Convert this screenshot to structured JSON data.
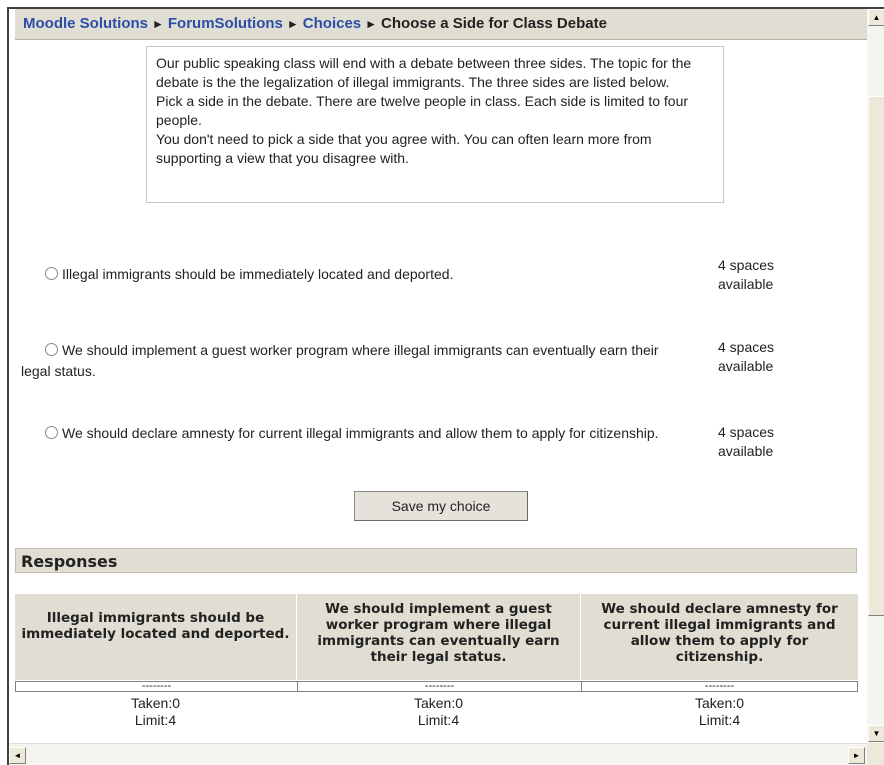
{
  "breadcrumb": {
    "items": [
      "Moodle Solutions",
      "ForumSolutions",
      "Choices"
    ],
    "separator": "►",
    "current": "Choose a Side for Class Debate"
  },
  "intro": {
    "paragraphs": [
      "Our public speaking class will end with a debate between three sides. The topic for the debate is the the legalization of illegal immigrants. The three sides are listed below.",
      "Pick a side in the debate. There are twelve people in class. Each side is limited to four people.",
      "You don't need to pick a side that you agree with. You can often learn more from supporting a view that you disagree with."
    ]
  },
  "options": [
    {
      "label": "Illegal immigrants should be immediately located and deported.",
      "spaces": "4 spaces available"
    },
    {
      "label": "We should implement a guest worker program where illegal immigrants can eventually earn their legal status.",
      "spaces": "4 spaces available"
    },
    {
      "label": "We should declare amnesty for current illegal immigrants and allow them to apply for citizenship.",
      "spaces": "4 spaces available"
    }
  ],
  "save_button": "Save my choice",
  "responses": {
    "title": "Responses",
    "columns": [
      {
        "header": "Illegal immigrants should be immediately located and deported.",
        "placeholder": "--------",
        "taken": "Taken:0",
        "limit": "Limit:4"
      },
      {
        "header": "We should implement a guest worker program where illegal immigrants can eventually earn their legal status.",
        "placeholder": "--------",
        "taken": "Taken:0",
        "limit": "Limit:4"
      },
      {
        "header": "We should declare amnesty for current illegal immigrants and allow them to apply for citizenship.",
        "placeholder": "--------",
        "taken": "Taken:0",
        "limit": "Limit:4"
      }
    ]
  },
  "colors": {
    "link": "#2c4ea8",
    "header_bg": "#e0ddd2"
  },
  "icons": {
    "scroll_up": "up-arrow",
    "scroll_down": "down-arrow",
    "scroll_left": "left-arrow",
    "scroll_right": "right-arrow"
  }
}
